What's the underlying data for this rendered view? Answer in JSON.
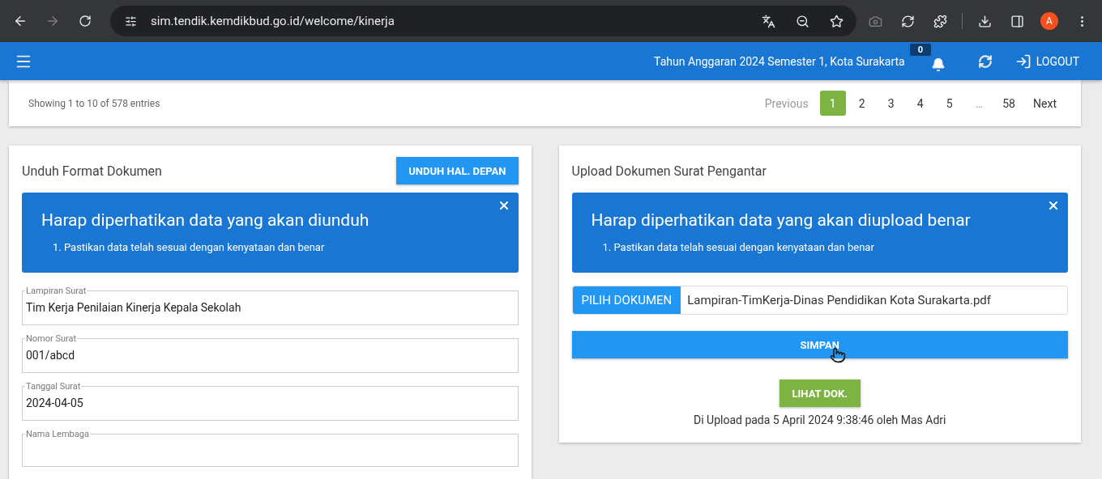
{
  "browser": {
    "url": "sim.tendik.kemdikbud.go.id/welcome/kinerja",
    "profile_initial": "A"
  },
  "app_bar": {
    "context": "Tahun Anggaran 2024 Semester 1, Kota Surakarta",
    "notification_count": "0",
    "logout": "LOGOUT"
  },
  "table_footer": {
    "info": "Showing 1 to 10 of 578 entries",
    "pagination": [
      {
        "label": "Previous",
        "kind": "nav",
        "disabled": true
      },
      {
        "label": "1",
        "kind": "page",
        "selected": true
      },
      {
        "label": "2",
        "kind": "page",
        "selected": false
      },
      {
        "label": "3",
        "kind": "page",
        "selected": false
      },
      {
        "label": "4",
        "kind": "page",
        "selected": false
      },
      {
        "label": "5",
        "kind": "page",
        "selected": false
      },
      {
        "label": "…",
        "kind": "ellipsis"
      },
      {
        "label": "58",
        "kind": "page",
        "selected": false
      },
      {
        "label": "Next",
        "kind": "nav",
        "disabled": false
      }
    ]
  },
  "download_card": {
    "title": "Unduh Format Dokumen",
    "button": "UNDUH HAL. DEPAN",
    "alert": {
      "heading": "Harap diperhatikan data yang akan diunduh",
      "items": [
        "1. Pastikan data telah sesuai dengan kenyataan dan benar"
      ]
    },
    "fields": [
      {
        "label": "Lampiran Surat",
        "value": "Tim Kerja Penilaian Kinerja Kepala Sekolah"
      },
      {
        "label": "Nomor Surat",
        "value": "001/abcd"
      },
      {
        "label": "Tanggal Surat",
        "value": "2024-04-05"
      },
      {
        "label": "Nama Lembaga"
      }
    ]
  },
  "upload_card": {
    "title": "Upload Dokumen Surat Pengantar",
    "alert": {
      "heading": "Harap diperhatikan data yang akan diupload benar",
      "items": [
        "1. Pastikan data telah sesuai dengan kenyataan dan benar"
      ]
    },
    "file_button": "PILIH DOKUMEN",
    "file_name": "Lampiran-TimKerja-Dinas Pendidikan Kota Surakarta.pdf",
    "save_button": "SIMPAN",
    "view_button": "LIHAT DOK.",
    "upload_info": "Di Upload pada 5 April 2024 9:38:46 oleh Mas Adri"
  }
}
